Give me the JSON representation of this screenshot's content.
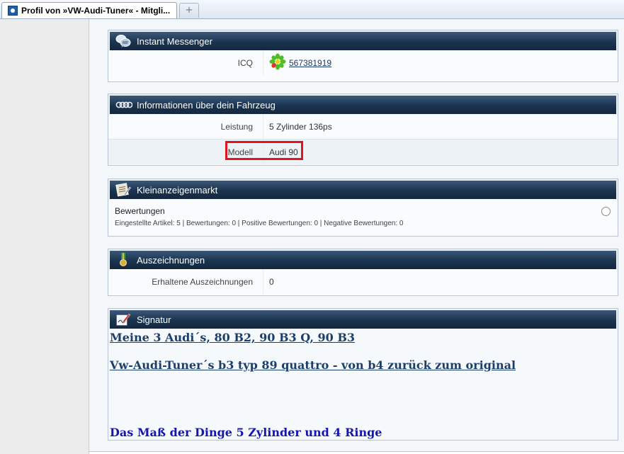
{
  "browser": {
    "tab_title": "Profil von »VW-Audi-Tuner« - Mitgli...",
    "new_tab_symbol": "+"
  },
  "instant_messenger": {
    "title": "Instant Messenger",
    "icon": "chat-bubbles-icon",
    "rows": [
      {
        "label": "ICQ",
        "value": "567381919",
        "icon": "icq-flower-icon"
      }
    ]
  },
  "vehicle": {
    "title": "Informationen über dein Fahrzeug",
    "icon": "audi-rings-icon",
    "rows": [
      {
        "label": "Leistung",
        "value": "5 Zylinder 136ps"
      },
      {
        "label": "Modell",
        "value": "Audi 90"
      }
    ]
  },
  "classifieds": {
    "title": "Kleinanzeigenmarkt",
    "icon": "notepad-icon",
    "ratings_title": "Bewertungen",
    "ratings_stats": "Eingestellte Artikel: 5 | Bewertungen: 0 | Positive Bewertungen: 0 | Negative Bewertungen: 0"
  },
  "awards": {
    "title": "Auszeichnungen",
    "icon": "medal-icon",
    "rows": [
      {
        "label": "Erhaltene Auszeichnungen",
        "value": "0"
      }
    ]
  },
  "signature": {
    "title": "Signatur",
    "icon": "pen-signature-icon",
    "line1": "Meine 3 Audi´s, 80 B2, 90 B3 Q, 90 B3",
    "line2": "Vw-Audi-Tuner´s b3 typ 89 quattro - von b4 zurück zum original",
    "line3": "Das Maß der Dinge 5 Zylinder und 4 Ringe"
  },
  "colors": {
    "header_bg": "#1a334f",
    "highlight": "#e1131d",
    "link": "#1c3b64",
    "signature_blue": "#1515b0"
  }
}
